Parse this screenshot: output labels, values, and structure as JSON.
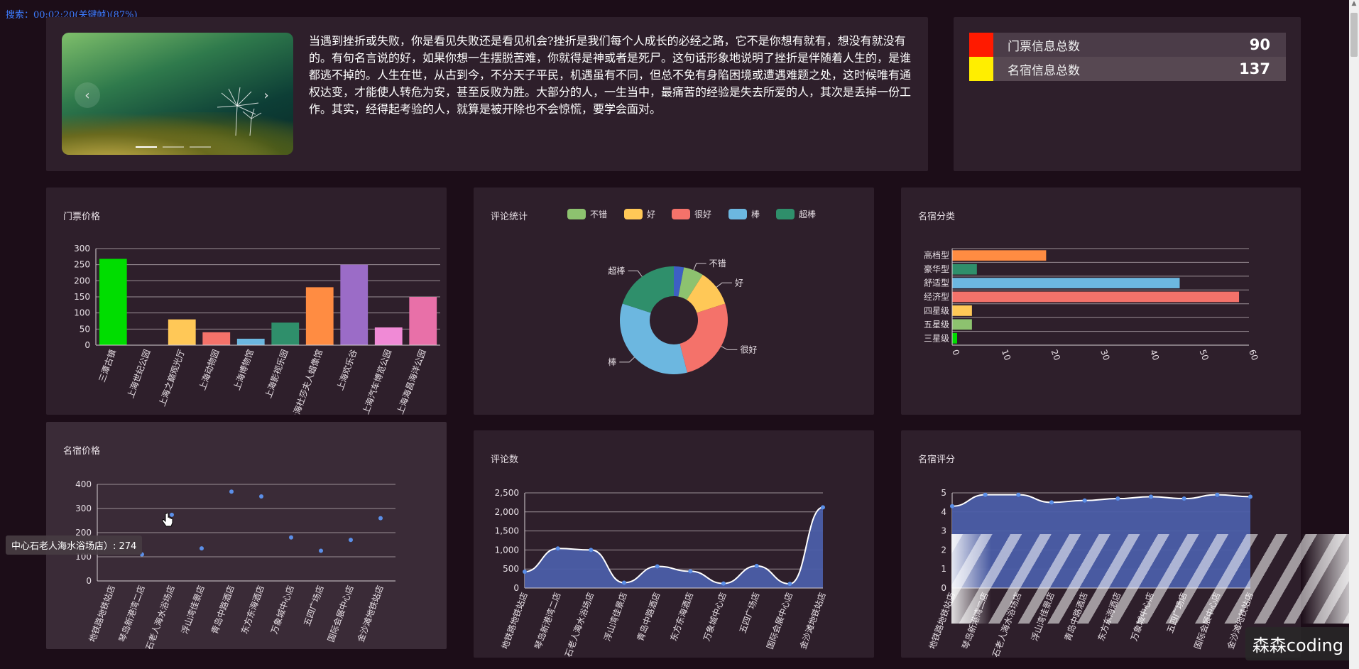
{
  "overlay": {
    "search_status": "搜索：00:02:20(关键帧)(87%)"
  },
  "banner": {
    "prev_arrow": "‹",
    "next_arrow": "›",
    "text": "当遇到挫折或失败，你是看见失败还是看见机会?挫折是我们每个人成长的必经之路，它不是你想有就有，想没有就没有的。有句名言说的好，如果你想一生摆脱苦难，你就得是神或者是死尸。这句话形象地说明了挫折是伴随着人生的，是谁都逃不掉的。人生在世，从古到今，不分天子平民，机遇虽有不同，但总不免有身陷困境或遭遇难题之处，这时候唯有通权达变，才能使人转危为安，甚至反败为胜。大部分的人，一生当中，最痛苦的经验是失去所爱的人，其次是丢掉一份工作。其实，经得起考验的人，就算是被开除也不会惊慌，要学会面对。"
  },
  "stats": [
    {
      "label": "门票信息总数",
      "value": "90",
      "color": "#ff1a00"
    },
    {
      "label": "名宿信息总数",
      "value": "137",
      "color": "#ffee00"
    }
  ],
  "tooltip": {
    "text": "中心石老人海水浴场店）: 274"
  },
  "watermark": {
    "text": "森森coding"
  },
  "charts": {
    "ticket_price": {
      "title": "门票价格",
      "chart_data": {
        "type": "bar",
        "categories": [
          "三潭古镇",
          "上海世纪公园",
          "上海之巅观光厅",
          "上海动物园",
          "上海博物馆",
          "上海影视乐园",
          "上海杜莎夫人蜡像馆",
          "上海欢乐谷",
          "上海汽车博览公园",
          "上海海昌海洋公园"
        ],
        "values": [
          268,
          0,
          80,
          40,
          20,
          70,
          180,
          250,
          55,
          150
        ],
        "colors": [
          "#00dd00",
          "#00dd00",
          "#ffc857",
          "#f4726a",
          "#6cb7e0",
          "#2f8f6b",
          "#ff8c42",
          "#9b6cc7",
          "#f08ad6",
          "#e870a8"
        ],
        "ylim": [
          0,
          300
        ],
        "yticks": [
          0,
          50,
          100,
          150,
          200,
          250,
          300
        ]
      }
    },
    "comments": {
      "title": "评论统计",
      "chart_data": {
        "type": "pie",
        "legend": [
          "不错",
          "好",
          "很好",
          "棒",
          "超棒"
        ],
        "slices": [
          {
            "name": "不错",
            "value": 6,
            "color": "#8dc26f"
          },
          {
            "name": "好",
            "value": 11,
            "color": "#ffc857"
          },
          {
            "name": "很好",
            "value": 26,
            "color": "#f4726a"
          },
          {
            "name": "棒",
            "value": 34,
            "color": "#6cb7e0"
          },
          {
            "name": "超棒",
            "value": 20,
            "color": "#2f8f6b"
          },
          {
            "name": "",
            "value": 3,
            "color": "#3d5fc4"
          }
        ]
      }
    },
    "homestay_category": {
      "title": "名宿分类",
      "chart_data": {
        "type": "bar",
        "orientation": "horizontal",
        "categories": [
          "高档型",
          "豪华型",
          "舒适型",
          "经济型",
          "四星级",
          "五星级",
          "三星级"
        ],
        "values": [
          19,
          5,
          46,
          58,
          4,
          4,
          1
        ],
        "colors": [
          "#ff8c42",
          "#2f8f6b",
          "#6cb7e0",
          "#f4726a",
          "#ffc857",
          "#8dc26f",
          "#00dd00"
        ],
        "xlim": [
          0,
          60
        ],
        "xticks": [
          0,
          10,
          20,
          30,
          40,
          50,
          60
        ]
      }
    },
    "homestay_price": {
      "title": "名宿价格",
      "chart_data": {
        "type": "scatter",
        "categories": [
          "地铁路地铁站店",
          "琴岛新港湾二店",
          "石老人海水浴场店",
          "浮山湾佳景店",
          "青岛中路酒店",
          "东方东海酒店",
          "万象城中心店",
          "五四广场店",
          "国际会展中心店",
          "金沙滩地铁站店"
        ],
        "values": [
          0,
          110,
          274,
          135,
          370,
          350,
          180,
          125,
          170,
          260
        ],
        "ylim": [
          0,
          400
        ],
        "yticks": [
          0,
          100,
          200,
          300,
          400
        ]
      }
    },
    "comment_count": {
      "title": "评论数",
      "chart_data": {
        "type": "area",
        "categories": [
          "地铁路地铁站店",
          "琴岛新港湾二店",
          "石老人海水浴场店",
          "浮山湾佳景店",
          "青岛中路酒店",
          "东方东海酒店",
          "万象城中心店",
          "五四广场店",
          "国际会展中心店",
          "金沙滩地铁站店"
        ],
        "values": [
          430,
          1040,
          1000,
          140,
          570,
          440,
          120,
          580,
          110,
          2120
        ],
        "ylim": [
          0,
          2500
        ],
        "yticks": [
          "0",
          "500",
          "1,000",
          "1,500",
          "2,000",
          "2,500"
        ]
      }
    },
    "homestay_rating": {
      "title": "名宿评分",
      "chart_data": {
        "type": "area",
        "categories": [
          "地铁路地铁站店",
          "琴岛新港湾二店",
          "石老人海水浴场店",
          "浮山湾佳景店",
          "青岛中路酒店",
          "东方东海酒店",
          "万象城中心店",
          "五四广场店",
          "国际会展中心店",
          "金沙滩地铁站店"
        ],
        "values": [
          4.3,
          4.9,
          4.9,
          4.5,
          4.6,
          4.7,
          4.8,
          4.7,
          4.9,
          4.8
        ],
        "ylim": [
          0,
          5
        ],
        "yticks": [
          0,
          1,
          2,
          3,
          4,
          5
        ]
      }
    }
  }
}
